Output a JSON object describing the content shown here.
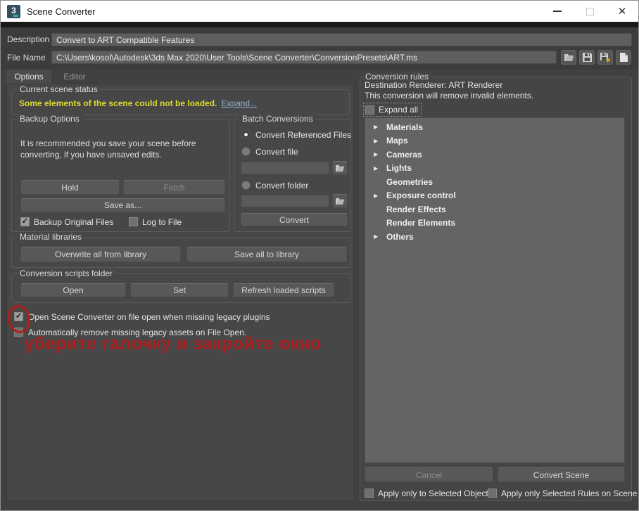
{
  "colors": {
    "warning_yellow": "#dedd2e",
    "link_blue": "#92b7d6",
    "annotation_red": "#b21d1d",
    "logo_teal": "#2ab5a5",
    "titlebar_bg": "#ffffff",
    "panel_bg": "#474747",
    "tree_bg": "#646464"
  },
  "titlebar": {
    "title": "Scene Converter",
    "logo_text": "3",
    "close_glyph": "✕"
  },
  "header": {
    "description_label": "Description",
    "description_value": "Convert to ART Compatible Features",
    "file_name_label": "File Name",
    "file_name_value": "C:\\Users\\kosol\\Autodesk\\3ds Max 2020\\User Tools\\Scene Converter\\ConversionPresets\\ART.ms",
    "icons": [
      "open-folder-icon",
      "save-icon",
      "save-as-icon",
      "new-document-icon"
    ]
  },
  "tabs": {
    "options": "Options",
    "editor": "Editor"
  },
  "scene_status": {
    "group_title": "Current scene status",
    "warning": "Some elements of the scene could not be loaded.",
    "expand_link": "Expand..."
  },
  "backup": {
    "group_title": "Backup Options",
    "info": "It is recommended you save your scene before converting, if you have unsaved edits.",
    "hold": "Hold",
    "fetch": "Fetch",
    "save_as": "Save as...",
    "backup_original": "Backup Original Files",
    "backup_original_checked": true,
    "log_to_file": "Log to File",
    "log_to_file_checked": false
  },
  "batch": {
    "group_title": "Batch Conversions",
    "radio_referenced": "Convert Referenced Files",
    "radio_referenced_selected": true,
    "radio_file": "Convert file",
    "radio_file_selected": false,
    "file_value": "",
    "radio_folder": "Convert folder",
    "radio_folder_selected": false,
    "folder_value": "",
    "convert": "Convert"
  },
  "material_libraries": {
    "group_title": "Material libraries",
    "overwrite": "Overwrite all from library",
    "save_all": "Save all to library"
  },
  "scripts_folder": {
    "group_title": "Conversion scripts folder",
    "open": "Open",
    "set": "Set",
    "refresh": "Refresh loaded scripts"
  },
  "startup_options": {
    "open_on_missing": "Open Scene Converter on file open when missing legacy plugins",
    "open_on_missing_checked": true,
    "auto_remove": "Automatically remove missing legacy assets on File Open.",
    "auto_remove_checked": false
  },
  "annotation": {
    "text": "уберите галочку и закройте окно"
  },
  "rules": {
    "group_title": "Conversion rules",
    "destination": "Destination Renderer: ART Renderer",
    "note": "This conversion will remove invalid elements.",
    "expand_all": "Expand all",
    "expand_all_checked": false,
    "arrow_glyph": "▶",
    "tree": [
      {
        "label": "Materials",
        "has_children": true
      },
      {
        "label": "Maps",
        "has_children": true
      },
      {
        "label": "Cameras",
        "has_children": true
      },
      {
        "label": "Lights",
        "has_children": true
      },
      {
        "label": "Geometries",
        "has_children": false
      },
      {
        "label": "Exposure control",
        "has_children": true
      },
      {
        "label": "Render Effects",
        "has_children": false
      },
      {
        "label": "Render Elements",
        "has_children": false
      },
      {
        "label": "Others",
        "has_children": true
      }
    ],
    "cancel": "Cancel",
    "convert_scene": "Convert Scene",
    "apply_selected_objects": "Apply only to Selected Objects",
    "apply_selected_objects_checked": false,
    "apply_selected_rules": "Apply only Selected Rules on Scene",
    "apply_selected_rules_checked": false
  }
}
